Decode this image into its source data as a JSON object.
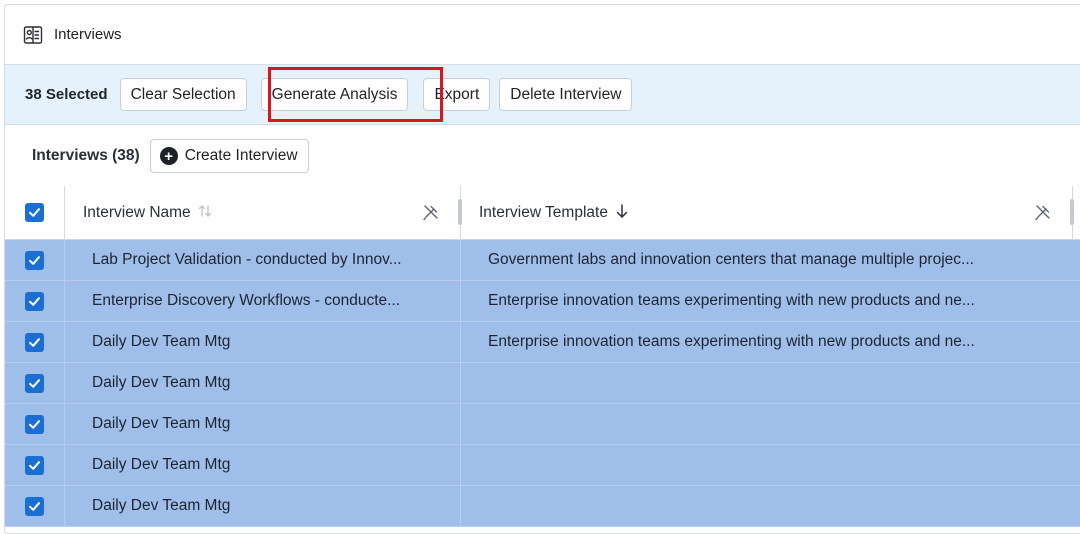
{
  "header": {
    "title": "Interviews",
    "icon": "contact-card-icon"
  },
  "selection": {
    "count_label": "38 Selected",
    "buttons": {
      "clear": "Clear Selection",
      "generate": "Generate Analysis",
      "export": "Export",
      "delete": "Delete Interview"
    }
  },
  "list": {
    "title": "Interviews (38)",
    "create_label": "Create Interview"
  },
  "table": {
    "columns": {
      "name": "Interview Name",
      "template": "Interview Template"
    },
    "rows": [
      {
        "name": "Lab Project Validation - conducted by Innov...",
        "template": "Government labs and innovation centers that manage multiple projec...",
        "checked": true
      },
      {
        "name": "Enterprise Discovery Workflows - conducte...",
        "template": "Enterprise innovation teams experimenting with new products and ne...",
        "checked": true
      },
      {
        "name": "Daily Dev Team Mtg",
        "template": "Enterprise innovation teams experimenting with new products and ne...",
        "checked": true
      },
      {
        "name": "Daily Dev Team Mtg",
        "template": "",
        "checked": true
      },
      {
        "name": "Daily Dev Team Mtg",
        "template": "",
        "checked": true
      },
      {
        "name": "Daily Dev Team Mtg",
        "template": "",
        "checked": true
      },
      {
        "name": "Daily Dev Team Mtg",
        "template": "",
        "checked": true
      }
    ]
  },
  "colors": {
    "selection_bar": "#e6f2fb",
    "selected_row": "#9fbfea",
    "checkbox": "#1c6fd2",
    "highlight": "#d8161b"
  }
}
